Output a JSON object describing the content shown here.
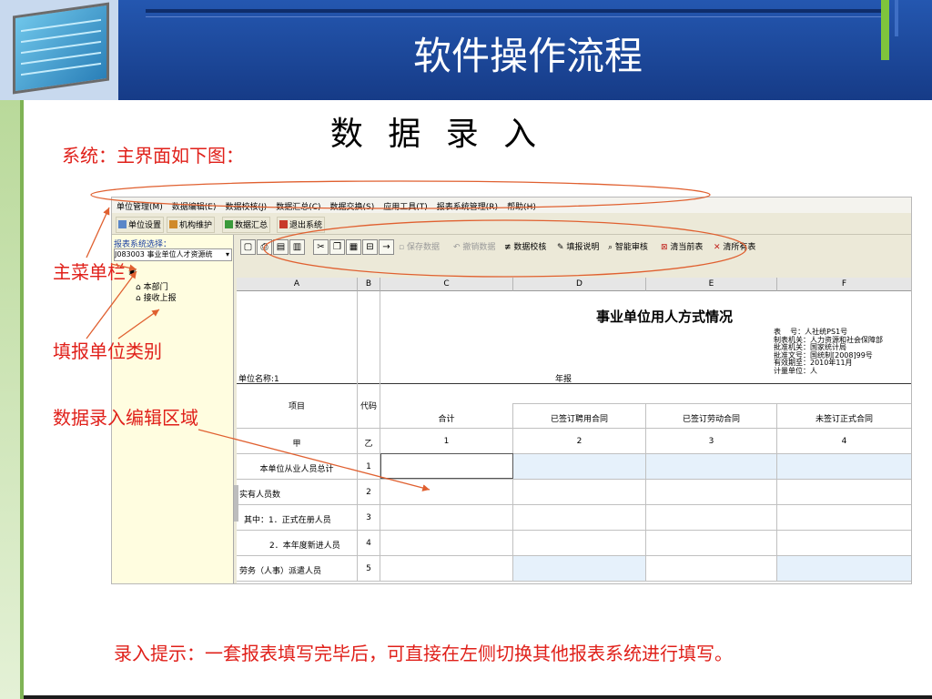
{
  "slide": {
    "title": "软件操作流程",
    "subtitle": "数 据 录 入",
    "system_note": "系统：主界面如下图：",
    "labels": {
      "main_menu": "主菜单栏",
      "unit_category": "填报单位类别",
      "edit_area": "数据录入编辑区域"
    },
    "tip": "录入提示：一套报表填写完毕后，可直接在左侧切换其他报表系统进行填写。",
    "colors": {
      "header": "#1b4aa0",
      "accent_red": "#e0201a",
      "accent_green": "#7fc43c"
    }
  },
  "app": {
    "menu": [
      "单位管理(M)",
      "数据编辑(E)",
      "数据校核(J)",
      "数据汇总(C)",
      "数据交换(S)",
      "应用工具(T)",
      "报表系统管理(R)",
      "帮助(H)"
    ],
    "toolbar1": [
      {
        "label": "单位设置",
        "icon": "unit-settings-icon"
      },
      {
        "label": "机构维护",
        "icon": "org-maintain-icon"
      },
      {
        "label": "数据汇总",
        "icon": "data-summary-icon"
      },
      {
        "label": "退出系统",
        "icon": "exit-icon"
      }
    ],
    "sidebar": {
      "label": "报表系统选择：",
      "selected": "J083003 事业单位人才资源统",
      "tree": [
        "本部门",
        "接收上报"
      ]
    },
    "toolbar2": {
      "save": "保存数据",
      "undo": "撤销数据",
      "check": "数据校核",
      "fill_help": "填报说明",
      "smart_audit": "智能审核",
      "clear_current": "清当前表",
      "clear_all": "清所有表"
    },
    "sheet": {
      "columns": [
        "A",
        "B",
        "C",
        "D",
        "E",
        "F"
      ],
      "report_title": "事业单位用人方式情况",
      "unit_name": "单位名称:1",
      "period": "年报",
      "meta": "表    号：人社统PS1号\n制表机关：人力资源和社会保障部\n批准机关：国家统计局\n批准文号：国统制[2008]99号\n有效期至：2010年11月\n计量单位：人",
      "header_item": "项目",
      "header_code": "代码",
      "header_cols": [
        "合计",
        "已签订聘用合同",
        "已签订劳动合同",
        "未签订正式合同"
      ],
      "index_row": [
        "甲",
        "乙",
        "1",
        "2",
        "3",
        "4"
      ],
      "rows": [
        {
          "label": "本单位从业人员总计",
          "code": "1"
        },
        {
          "label": "实有人员数",
          "code": "2"
        },
        {
          "label": "其中：1．正式在册人员",
          "code": "3"
        },
        {
          "label": "2．本年度新进人员",
          "code": "4"
        },
        {
          "label": "劳务（人事）派遣人员",
          "code": "5"
        }
      ]
    }
  }
}
